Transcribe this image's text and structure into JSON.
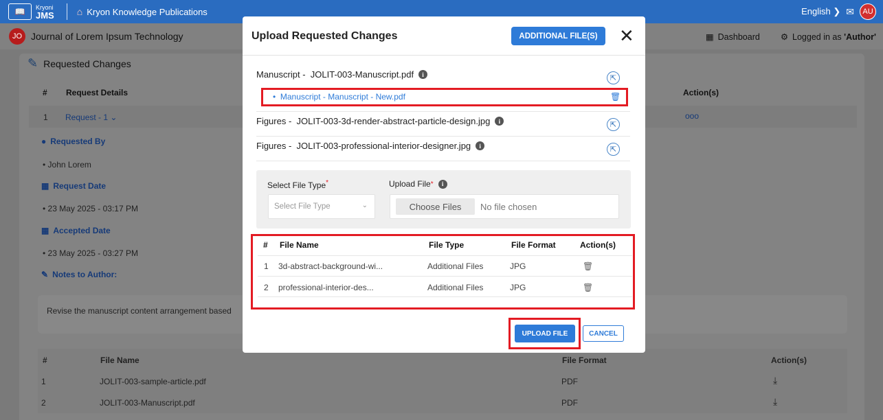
{
  "topbar": {
    "brand_small": "Kryoni",
    "brand_big": "JMS",
    "publication": "Kryon Knowledge Publications",
    "language": "English",
    "avatar": "AU",
    "colors": {
      "topbar": "#2a6cc0",
      "accent": "#2e7bd8",
      "highlight": "#e31b23"
    }
  },
  "subbar": {
    "journal_initials": "JO",
    "journal_title": "Journal of Lorem Ipsum Technology",
    "dashboard": "Dashboard",
    "logged_in_prefix": "Logged in as ",
    "logged_in_role": "'Author'"
  },
  "background": {
    "section_title": "Requested Changes",
    "col_hash": "#",
    "col_request_details": "Request Details",
    "col_actions": "Action(s)",
    "row_num": "1",
    "row_request": "Request - 1",
    "row_more": "ooo",
    "requested_by_label": "Requested By",
    "requested_by_value": "John Lorem",
    "request_date_label": "Request Date",
    "request_date_value": "23 May 2025 - 03:17 PM",
    "accepted_date_label": "Accepted Date",
    "accepted_date_value": "23 May 2025 - 03:27 PM",
    "notes_label": "Notes to Author:",
    "notes_text": "Revise the manuscript content arrangement based",
    "files_table": {
      "headers": [
        "#",
        "File Name",
        "File Format",
        "Action(s)"
      ],
      "rows": [
        {
          "num": "1",
          "name": "JOLIT-003-sample-article.pdf",
          "format": "PDF"
        },
        {
          "num": "2",
          "name": "JOLIT-003-Manuscript.pdf",
          "format": "PDF"
        }
      ]
    }
  },
  "modal": {
    "title": "Upload Requested Changes",
    "additional_button": "ADDITIONAL FILE(S)",
    "close": "✕",
    "files": [
      {
        "prefix": "Manuscript -",
        "name": "JOLIT-003-Manuscript.pdf"
      },
      {
        "prefix": "Figures -",
        "name": "JOLIT-003-3d-render-abstract-particle-design.jpg"
      },
      {
        "prefix": "Figures -",
        "name": "JOLIT-003-professional-interior-designer.jpg"
      }
    ],
    "new_file": "Manuscript - Manuscript - New.pdf",
    "form": {
      "file_type_label": "Select File Type",
      "file_type_placeholder": "Select File Type",
      "upload_label": "Upload File",
      "choose_button": "Choose Files",
      "no_file": "No file chosen"
    },
    "table": {
      "headers": [
        "#",
        "File Name",
        "File Type",
        "File Format",
        "Action(s)"
      ],
      "rows": [
        {
          "num": "1",
          "name": "3d-abstract-background-wi...",
          "type": "Additional Files",
          "format": "JPG"
        },
        {
          "num": "2",
          "name": "professional-interior-des...",
          "type": "Additional Files",
          "format": "JPG"
        }
      ]
    },
    "upload_button": "UPLOAD FILE",
    "cancel_button": "CANCEL"
  }
}
